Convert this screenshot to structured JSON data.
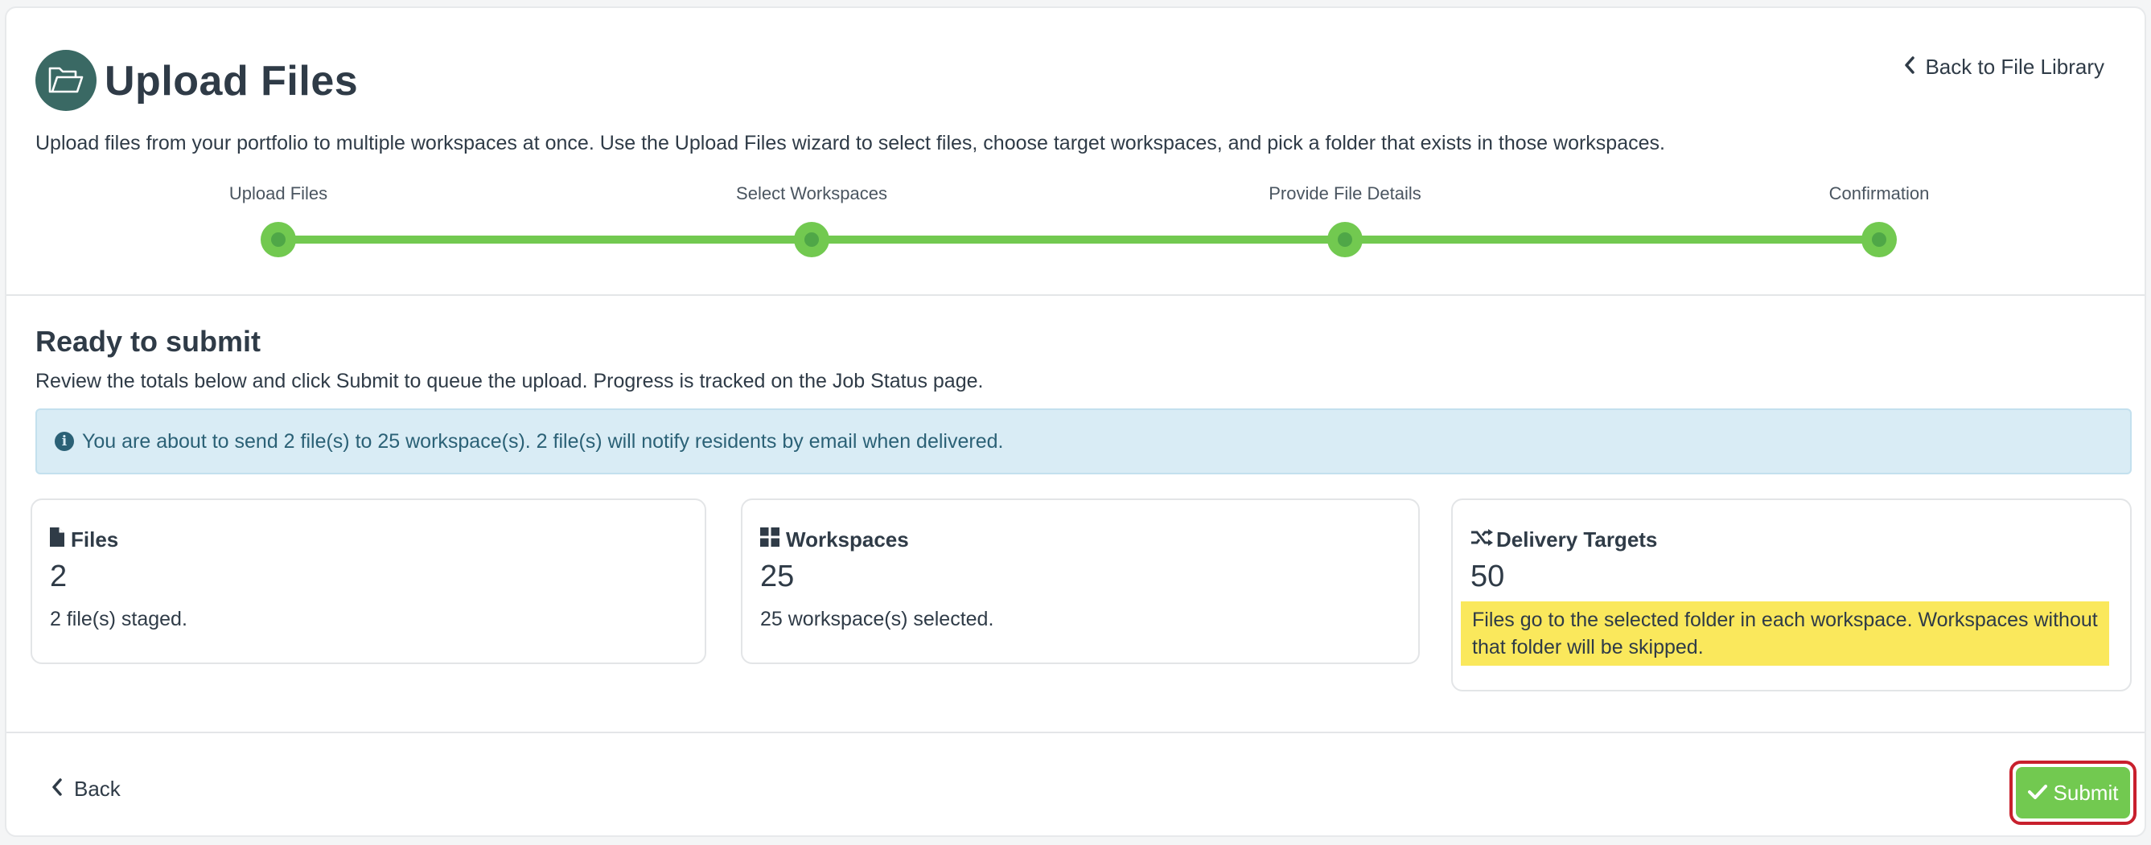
{
  "header": {
    "title": "Upload Files",
    "back_link": "Back to File Library",
    "intro": "Upload files from your portfolio to multiple workspaces at once. Use the Upload Files wizard to select files, choose target workspaces, and pick a folder that exists in those workspaces."
  },
  "stepper": {
    "steps": [
      {
        "label": "Upload Files",
        "state": "complete"
      },
      {
        "label": "Select Workspaces",
        "state": "complete"
      },
      {
        "label": "Provide File Details",
        "state": "complete"
      },
      {
        "label": "Confirmation",
        "state": "current"
      }
    ]
  },
  "review": {
    "title": "Ready to submit",
    "description": "Review the totals below and click Submit to queue the upload. Progress is tracked on the Job Status page.",
    "alert": "You are about to send 2 file(s) to 25 workspace(s). 2 file(s) will notify residents by email when delivered."
  },
  "stats": [
    {
      "title": "Files",
      "icon": "file-icon",
      "value": "2",
      "note": "2 file(s) staged."
    },
    {
      "title": "Workspaces",
      "icon": "grid-icon",
      "value": "25",
      "note": "25 workspace(s) selected."
    },
    {
      "title": "Delivery Targets",
      "icon": "shuffle-icon",
      "value": "50",
      "note": "Files go to the selected folder in each workspace. Workspaces without that folder will be skipped."
    }
  ],
  "footer": {
    "back_label": "Back",
    "submit_label": "Submit"
  },
  "colors": {
    "accent_green": "#72c950",
    "header_icon_bg": "#3a6964",
    "alert_bg": "#d9ecf5",
    "highlight": "#fae85c",
    "focus_ring": "#c8202d"
  }
}
